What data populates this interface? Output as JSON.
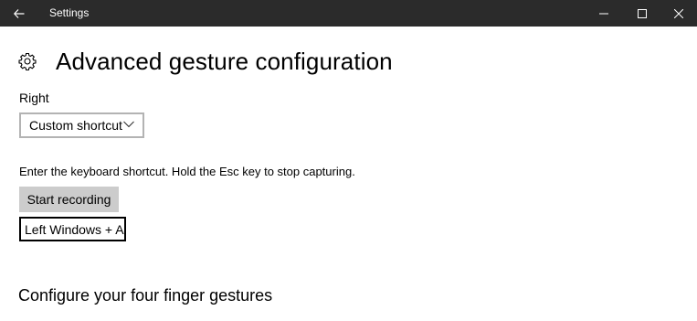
{
  "window": {
    "title": "Settings",
    "back_icon": "arrow-left-icon",
    "controls": [
      "minimize-icon",
      "maximize-icon",
      "close-icon"
    ],
    "titlebar_color": "#2b2b2b"
  },
  "page": {
    "icon": "gear-icon",
    "title": "Advanced gesture configuration"
  },
  "gesture": {
    "direction_label": "Right",
    "action_dropdown": {
      "selected": "Custom shortcut",
      "icon": "chevron-down-icon"
    },
    "instructions": "Enter the keyboard shortcut. Hold the Esc key to stop capturing.",
    "record_button": "Start recording",
    "shortcut_value": "Left Windows + A"
  },
  "section": {
    "four_finger_title": "Configure your four finger gestures"
  }
}
